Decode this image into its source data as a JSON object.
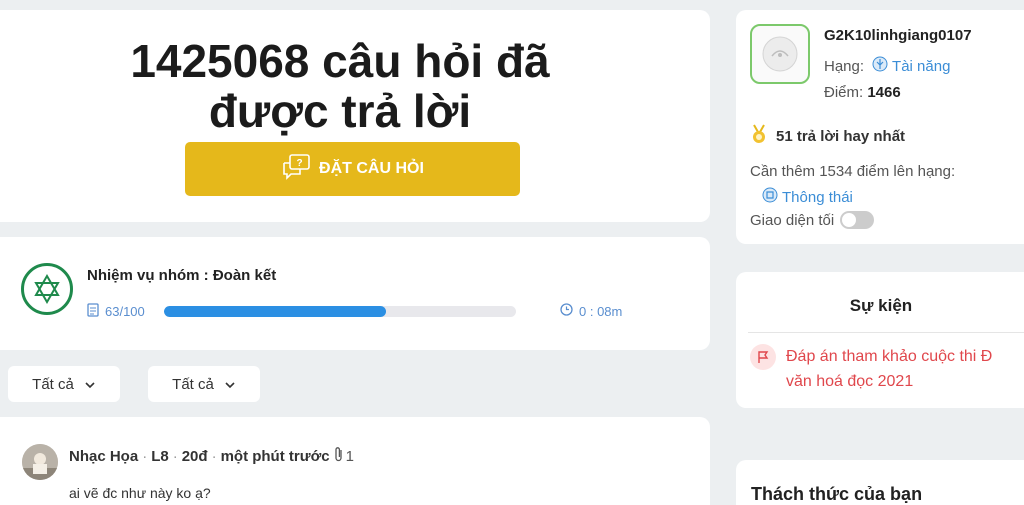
{
  "hero": {
    "title_line1": "1425068 câu hỏi đã",
    "title_line2": "được trả lời",
    "ask_button": "ĐẶT CÂU HỎI"
  },
  "mission": {
    "title": "Nhiệm vụ nhóm : Đoàn kết",
    "progress_text": "63/100",
    "progress_fraction": 0.63,
    "timer": "0 : 08m"
  },
  "filters": [
    {
      "label": "Tất cả"
    },
    {
      "label": "Tất cả"
    }
  ],
  "post": {
    "author": "Nhạc Họa",
    "level": "L8",
    "points": "20đ",
    "time": "một phút trước",
    "attachments": "1",
    "text": "ai vẽ đc như này ko ạ?"
  },
  "profile": {
    "username": "G2K10linhgiang0107",
    "rank_label": "Hạng:",
    "rank_value": "Tài năng",
    "points_label": "Điểm:",
    "points_value": "1466",
    "best_answers": "51 trả lời hay nhất",
    "need_more": "Cần thêm 1534 điểm lên hạng:",
    "next_rank": "Thông thái",
    "dark_mode_label": "Giao diện tối"
  },
  "events": {
    "title": "Sự kiện",
    "items": [
      {
        "line1": "Đáp án tham khảo cuộc thi Đ",
        "line2": "văn hoá đọc 2021"
      }
    ]
  },
  "challenge": {
    "title": "Thách thức của bạn"
  },
  "colors": {
    "accent_button": "#e5b81b",
    "progress": "#2b8fe3",
    "link": "#3b8dd6",
    "event_red": "#e0474c",
    "mission_green": "#1f8a4c"
  }
}
